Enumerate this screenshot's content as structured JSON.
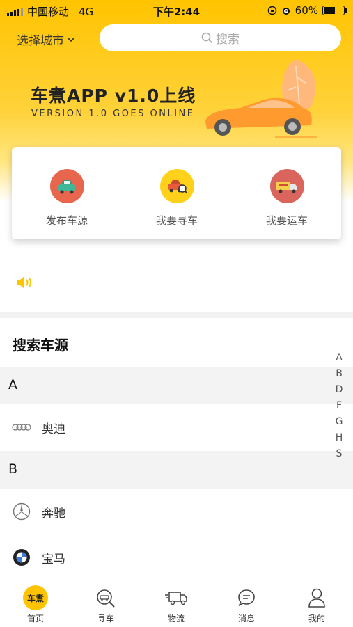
{
  "status_bar": {
    "carrier": "中国移动",
    "network": "4G",
    "time": "下午2:44",
    "battery": "60%",
    "battery_level": 0.6
  },
  "header": {
    "city_label": "选择城市",
    "search_placeholder": "搜索"
  },
  "banner": {
    "title": "车煮APP v1.0上线",
    "subtitle": "VERSION 1.0 GOES ONLINE"
  },
  "quick_actions": [
    {
      "label": "发布车源",
      "icon": "car-front-icon",
      "color": "#e8664e"
    },
    {
      "label": "我要寻车",
      "icon": "car-search-icon",
      "color": "#ffd11a"
    },
    {
      "label": "我要运车",
      "icon": "truck-icon",
      "color": "#d9655c"
    }
  ],
  "notice": {
    "icon": "speaker-icon",
    "color": "#ffc400"
  },
  "section": {
    "title": "搜索车源"
  },
  "brands": {
    "groups": [
      {
        "letter": "A",
        "items": [
          {
            "name": "奥迪",
            "icon": "audi-logo-icon"
          }
        ]
      },
      {
        "letter": "B",
        "items": [
          {
            "name": "奔驰",
            "icon": "mercedes-logo-icon"
          },
          {
            "name": "宝马",
            "icon": "bmw-logo-icon"
          }
        ]
      }
    ]
  },
  "alpha_index": [
    "A",
    "B",
    "D",
    "F",
    "G",
    "H",
    "S"
  ],
  "tabbar": {
    "active_color": "#ffc400",
    "items": [
      {
        "label": "首页",
        "icon": "home-logo-icon",
        "badge": "车煮"
      },
      {
        "label": "寻车",
        "icon": "car-search-icon"
      },
      {
        "label": "物流",
        "icon": "delivery-truck-icon"
      },
      {
        "label": "消息",
        "icon": "chat-bubble-icon"
      },
      {
        "label": "我的",
        "icon": "user-icon"
      }
    ]
  }
}
